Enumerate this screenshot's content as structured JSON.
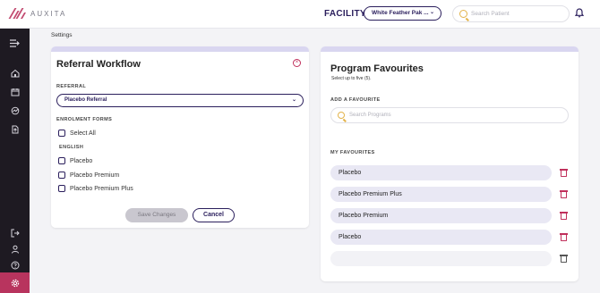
{
  "header": {
    "logo_text": "AUXITA",
    "facility_label": "FACILITY",
    "facility_value": "White Feather Pak ...",
    "search_placeholder": "Search Patient"
  },
  "breadcrumb": "Settings",
  "referral_workflow": {
    "title": "Referral Workflow",
    "referral_label": "REFERRAL",
    "referral_value": "Placebo Referral",
    "enrolment_label": "ENROLMENT FORMS",
    "select_all": "Select All",
    "language_label": "ENGLISH",
    "forms": [
      "Placebo",
      "Placebo Premium",
      "Placebo Premium Plus"
    ],
    "save_label": "Save Changes",
    "cancel_label": "Cancel"
  },
  "program_favourites": {
    "title": "Program Favourites",
    "subtitle": "Select up to five (5).",
    "add_label": "ADD A FAVOURITE",
    "search_placeholder": "Search Programs",
    "my_label": "MY FAVOURITES",
    "items": [
      "Placebo",
      "Placebo Premium Plus",
      "Placebo Premium",
      "Placebo",
      ""
    ]
  },
  "colors": {
    "accent": "#2a1e5c",
    "brand": "#b8345e",
    "sidebar": "#1e1a22",
    "favourite_bg": "#e9e8f4"
  },
  "icons": [
    "menu-collapse-icon",
    "home-icon",
    "calendar-icon",
    "analytics-icon",
    "upload-icon",
    "logout-icon",
    "user-icon",
    "help-icon",
    "settings-icon",
    "bell-icon",
    "search-icon",
    "close-icon",
    "trash-icon"
  ]
}
